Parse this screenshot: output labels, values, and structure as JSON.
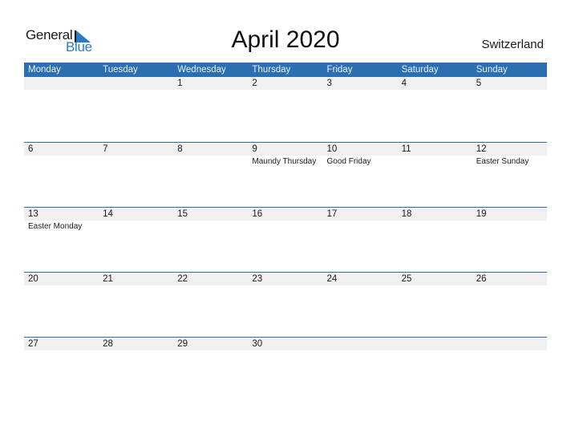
{
  "logo": {
    "word1": "General",
    "word2": "Blue"
  },
  "title": "April 2020",
  "country": "Switzerland",
  "colors": {
    "accent": "#2c6fb0",
    "strip": "#f0f0f0",
    "logo_blue": "#2a7bc4"
  },
  "weekdays": [
    "Monday",
    "Tuesday",
    "Wednesday",
    "Thursday",
    "Friday",
    "Saturday",
    "Sunday"
  ],
  "weeks": [
    {
      "days": [
        {
          "date": "",
          "holiday": ""
        },
        {
          "date": "",
          "holiday": ""
        },
        {
          "date": "1",
          "holiday": ""
        },
        {
          "date": "2",
          "holiday": ""
        },
        {
          "date": "3",
          "holiday": ""
        },
        {
          "date": "4",
          "holiday": ""
        },
        {
          "date": "5",
          "holiday": ""
        }
      ]
    },
    {
      "days": [
        {
          "date": "6",
          "holiday": ""
        },
        {
          "date": "7",
          "holiday": ""
        },
        {
          "date": "8",
          "holiday": ""
        },
        {
          "date": "9",
          "holiday": "Maundy Thursday"
        },
        {
          "date": "10",
          "holiday": "Good Friday"
        },
        {
          "date": "11",
          "holiday": ""
        },
        {
          "date": "12",
          "holiday": "Easter Sunday"
        }
      ]
    },
    {
      "days": [
        {
          "date": "13",
          "holiday": "Easter Monday"
        },
        {
          "date": "14",
          "holiday": ""
        },
        {
          "date": "15",
          "holiday": ""
        },
        {
          "date": "16",
          "holiday": ""
        },
        {
          "date": "17",
          "holiday": ""
        },
        {
          "date": "18",
          "holiday": ""
        },
        {
          "date": "19",
          "holiday": ""
        }
      ]
    },
    {
      "days": [
        {
          "date": "20",
          "holiday": ""
        },
        {
          "date": "21",
          "holiday": ""
        },
        {
          "date": "22",
          "holiday": ""
        },
        {
          "date": "23",
          "holiday": ""
        },
        {
          "date": "24",
          "holiday": ""
        },
        {
          "date": "25",
          "holiday": ""
        },
        {
          "date": "26",
          "holiday": ""
        }
      ]
    },
    {
      "days": [
        {
          "date": "27",
          "holiday": ""
        },
        {
          "date": "28",
          "holiday": ""
        },
        {
          "date": "29",
          "holiday": ""
        },
        {
          "date": "30",
          "holiday": ""
        },
        {
          "date": "",
          "holiday": ""
        },
        {
          "date": "",
          "holiday": ""
        },
        {
          "date": "",
          "holiday": ""
        }
      ]
    }
  ]
}
